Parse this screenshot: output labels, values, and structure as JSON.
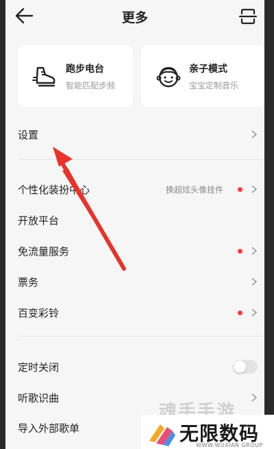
{
  "header": {
    "title": "更多"
  },
  "cards": [
    {
      "title": "跑步电台",
      "subtitle": "智能匹配步频",
      "icon": "running-shoe-icon"
    },
    {
      "title": "亲子模式",
      "subtitle": "宝宝定制音乐",
      "icon": "baby-face-icon"
    }
  ],
  "rows": {
    "settings": {
      "label": "设置"
    },
    "personalize": {
      "label": "个性化装扮中心",
      "extra": "换超炫头像挂件"
    },
    "open_platform": {
      "label": "开放平台"
    },
    "free_data": {
      "label": "免流量服务"
    },
    "tickets": {
      "label": "票务"
    },
    "ringtone": {
      "label": "百变彩铃"
    },
    "sleep_timer": {
      "label": "定时关闭",
      "enabled": false
    },
    "song_recognition": {
      "label": "听歌识曲"
    },
    "import_playlist": {
      "label": "导入外部歌单"
    }
  },
  "colors": {
    "accent_dot": "#ff3a3a",
    "annotation_arrow": "#e8322b"
  },
  "watermark": {
    "main": "无限数码",
    "sub": "WWW.WUXIAN GROUP",
    "faint": "魂手手游"
  }
}
